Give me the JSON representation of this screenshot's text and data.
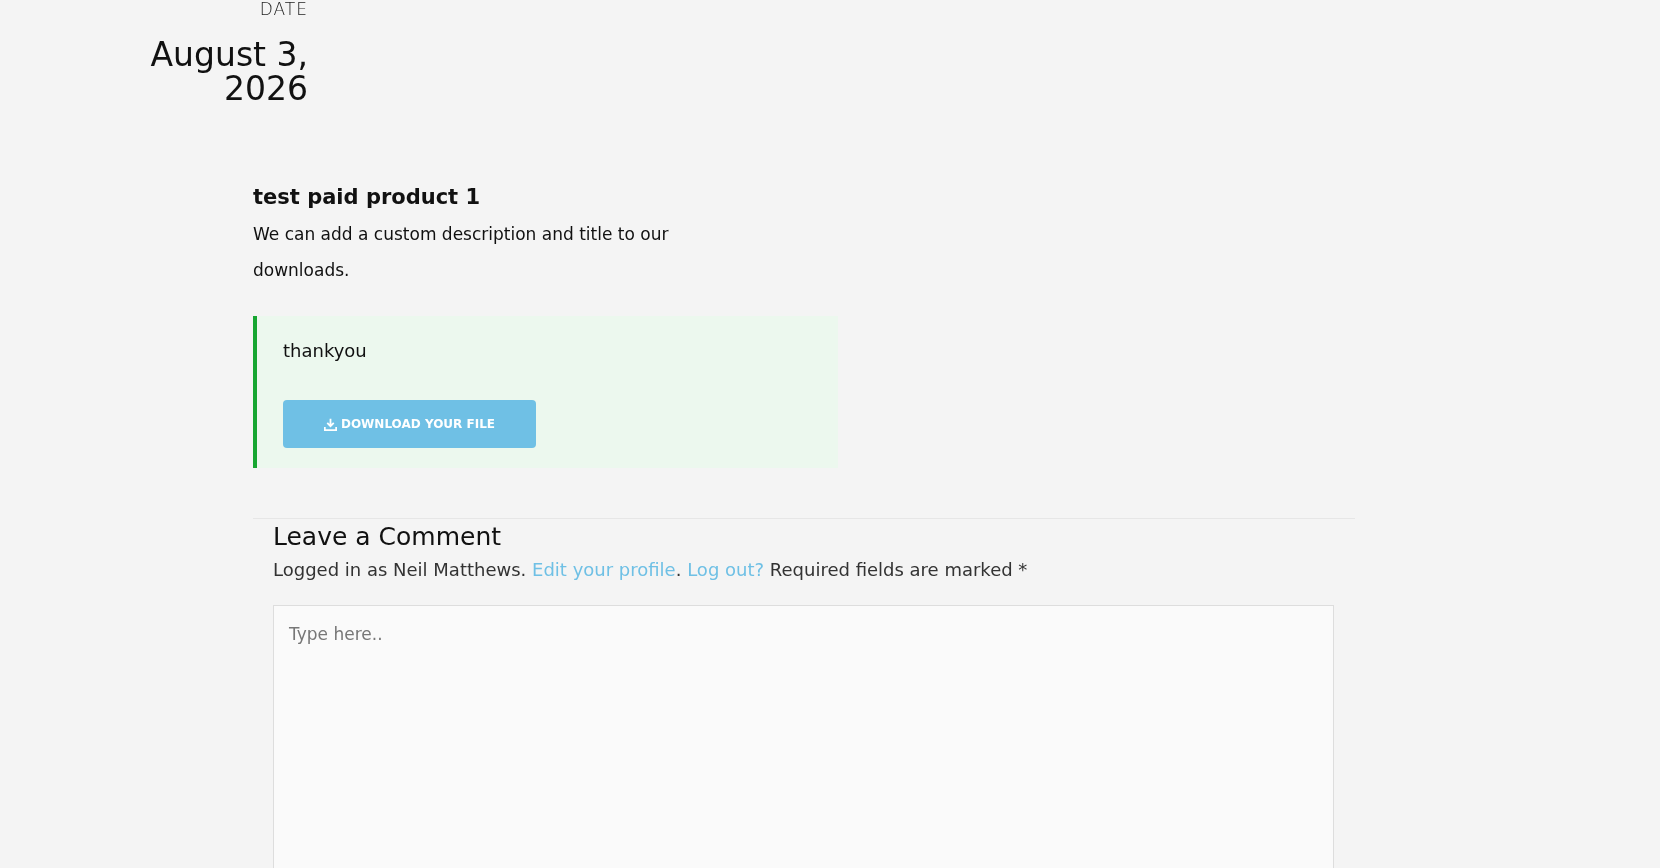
{
  "date": {
    "label": "DATE",
    "value": "August 3, 2026"
  },
  "product": {
    "title": "test paid product 1",
    "description": "We can add a custom description and title to our downloads."
  },
  "notice": {
    "message": "thankyou",
    "button": "DOWNLOAD YOUR FILE"
  },
  "comment": {
    "heading": "Leave a Comment",
    "logged_in": "Logged in as Neil Matthews.",
    "edit_link": "Edit your profile",
    "separator": ".",
    "logout_link": "Log out?",
    "required": "Required fields are marked *",
    "placeholder": "Type here.."
  }
}
